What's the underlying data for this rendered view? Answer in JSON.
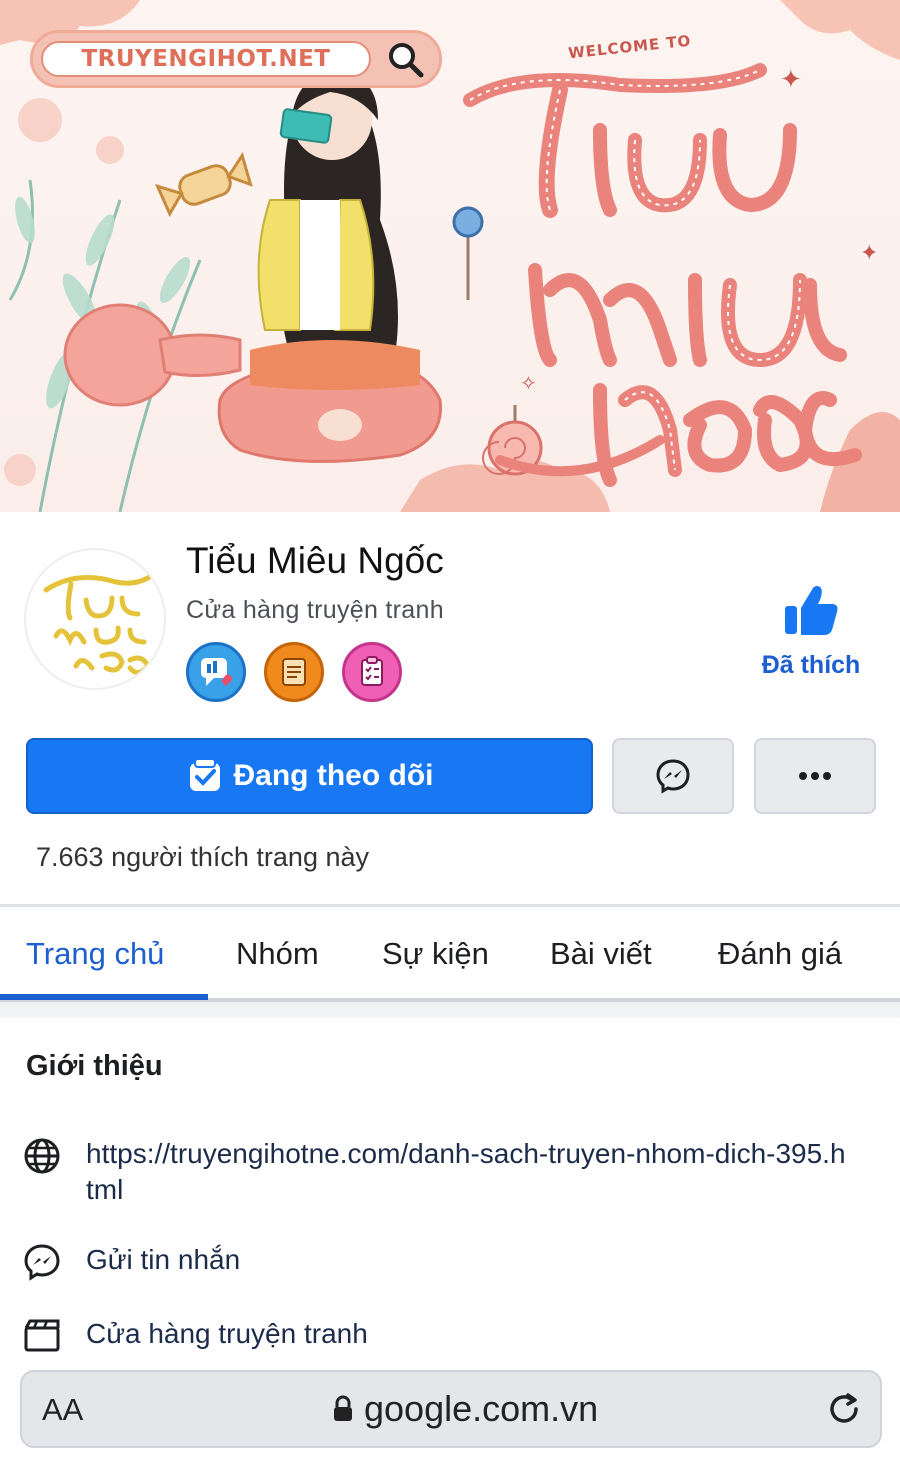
{
  "cover": {
    "watermark": "TRUYENGIHOT.NET",
    "welcome": "WELCOME TO",
    "script_title": [
      "Tiểu",
      "miêu",
      "ngọc"
    ]
  },
  "profile": {
    "name": "Tiểu Miêu Ngốc",
    "category": "Cửa hàng truyện tranh",
    "avatar_script": [
      "tiểu",
      "miêu",
      "ngọc"
    ],
    "liked_label": "Đã thích",
    "badges": [
      "chat-badge-icon",
      "clipboard-badge-icon",
      "checklist-badge-icon"
    ]
  },
  "actions": {
    "follow_label": "Đang theo dõi",
    "likes_text": "7.663 người thích trang này"
  },
  "tabs": [
    "Trang chủ",
    "Nhóm",
    "Sự kiện",
    "Bài viết",
    "Đánh giá"
  ],
  "intro": {
    "title": "Giới thiệu",
    "link": "https://truyengihotne.com/danh-sach-truyen-nhom-dich-395.html",
    "message": "Gửi tin nhắn",
    "category": "Cửa hàng truyện tranh"
  },
  "browser": {
    "aa": "AA",
    "url": "google.com.vn"
  },
  "colors": {
    "facebook_blue": "#1877f2",
    "active_tab": "#1b5fd1",
    "cover_pink": "#e9837b"
  }
}
